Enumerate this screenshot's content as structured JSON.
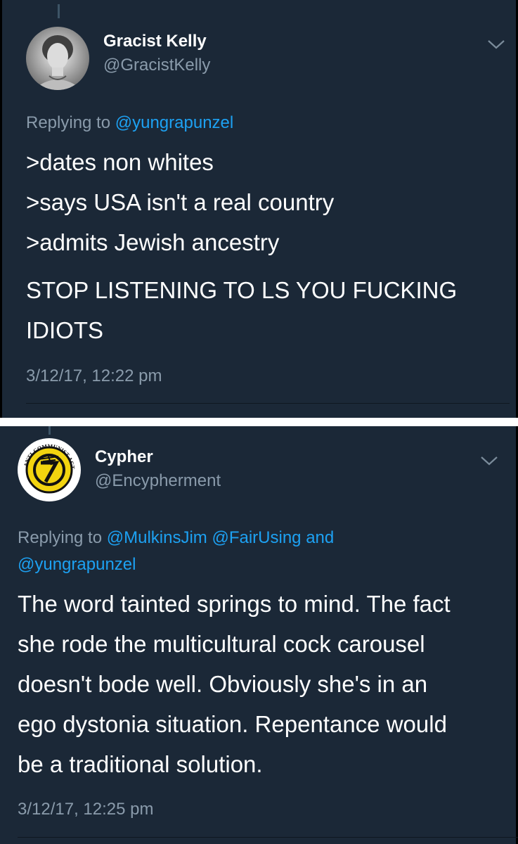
{
  "tweets": [
    {
      "name": "Gracist Kelly",
      "handle": "@GracistKelly",
      "reply_prefix": "Replying to ",
      "reply_mentions": [
        "@yungrapunzel"
      ],
      "lines": [
        ">dates non whites",
        ">says USA isn't a real country",
        ">admits Jewish ancestry"
      ],
      "shout_lines": [
        "STOP LISTENING TO LS YOU FUCKING",
        "IDIOTS"
      ],
      "timestamp": "3/12/17, 12:22 pm"
    },
    {
      "name": "Cypher",
      "handle": "@Encypherment",
      "reply_prefix": "Replying to ",
      "reply_mentions": [
        "@MulkinsJim",
        "@FairUsing"
      ],
      "reply_and": " and",
      "reply_last": "@yungrapunzel",
      "avatar_text": "ANTI-COMMUNIST ACTION",
      "lines": [
        "The word tainted springs to mind. The fact",
        "she rode the multicultural cock carousel",
        "doesn't bode well. Obviously she's in an",
        "ego dystonia situation. Repentance would",
        "be a traditional solution."
      ],
      "timestamp": "3/12/17, 12:25 pm"
    }
  ],
  "colors": {
    "bg": "#1b2837",
    "link": "#1da1f2",
    "muted": "#8a9bab",
    "text": "#ffffff"
  },
  "icons": [
    "chevron-down-icon"
  ]
}
